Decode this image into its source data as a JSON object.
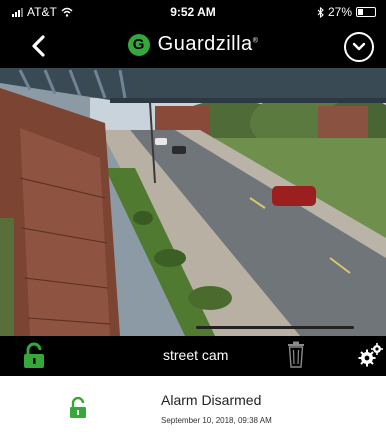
{
  "status_bar": {
    "carrier": "AT&T",
    "time": "9:52 AM",
    "battery_percent": "27%",
    "battery_level": 0.27
  },
  "nav": {
    "brand_initial": "G",
    "brand_name": "Guardzilla",
    "brand_mark": "®",
    "back_icon": "chevron-left-icon",
    "menu_icon": "chevron-down-circle-icon"
  },
  "camera": {
    "name": "street cam",
    "lock_icon": "unlocked-padlock-icon",
    "trash_icon": "trash-icon",
    "settings_icon": "gear-icon"
  },
  "alarm": {
    "status": "Alarm Disarmed",
    "timestamp": "September 10, 2018, 09:38 AM",
    "icon": "unlocked-padlock-icon"
  },
  "colors": {
    "accent_green": "#35a83a",
    "bar_black": "#000000"
  }
}
